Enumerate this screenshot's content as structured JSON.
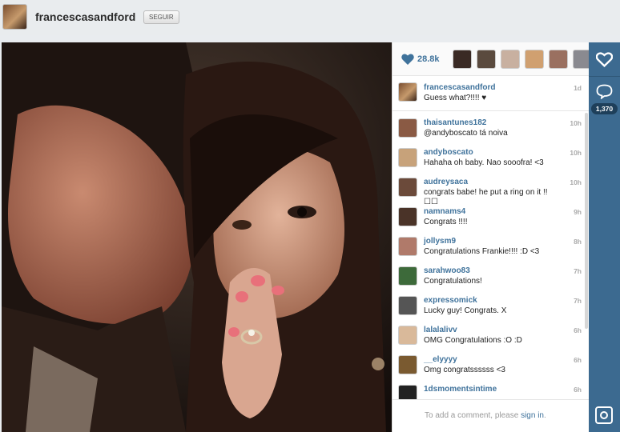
{
  "header": {
    "username": "francescasandford",
    "follow_label": "SEGUIR"
  },
  "post": {
    "likes": "28.8k",
    "caption": {
      "username": "francescasandford",
      "text": "Guess what?!!!! ♥",
      "time": "1d"
    },
    "comments": [
      {
        "username": "thaisantunes182",
        "text": "@andyboscato tá noiva",
        "time": "10h",
        "avatar_color": "#8a5a44"
      },
      {
        "username": "andyboscato",
        "text": "Hahaha oh baby. Nao sooofra! <3",
        "time": "10h",
        "avatar_color": "#c7a27a"
      },
      {
        "username": "audreysaca",
        "text": "congrats babe! he put a ring on it !! ☐☐",
        "time": "10h",
        "avatar_color": "#6b4a3a"
      },
      {
        "username": "namnams4",
        "text": "Congrats !!!!",
        "time": "9h",
        "avatar_color": "#4a3328"
      },
      {
        "username": "jollysm9",
        "text": "Congratulations Frankie!!!! :D <3",
        "time": "8h",
        "avatar_color": "#b07a6a"
      },
      {
        "username": "sarahwoo83",
        "text": "Congratulations!",
        "time": "7h",
        "avatar_color": "#3d6a3a"
      },
      {
        "username": "expressomick",
        "text": "Lucky guy! Congrats. X",
        "time": "7h",
        "avatar_color": "#555555"
      },
      {
        "username": "lalalalivv",
        "text": "OMG Congratulations :O :D",
        "time": "6h",
        "avatar_color": "#d9b99a"
      },
      {
        "username": "__elyyyy",
        "text": "Omg congratssssss <3",
        "time": "6h",
        "avatar_color": "#7a5a30"
      },
      {
        "username": "1dsmomentsintime",
        "text": "",
        "time": "6h",
        "avatar_color": "#222222"
      }
    ],
    "add_comment_prefix": "To add a comment, please ",
    "add_comment_link": "sign in",
    "add_comment_suffix": "."
  },
  "rail": {
    "comment_count": "1,370"
  },
  "icons": {
    "likes": "heart-icon",
    "rail_like": "heart-icon",
    "rail_comment": "comment-bubble-icon",
    "rail_camera": "instagram-camera-icon"
  },
  "colors": {
    "link": "#3f729b",
    "rail": "#3c6a90"
  }
}
